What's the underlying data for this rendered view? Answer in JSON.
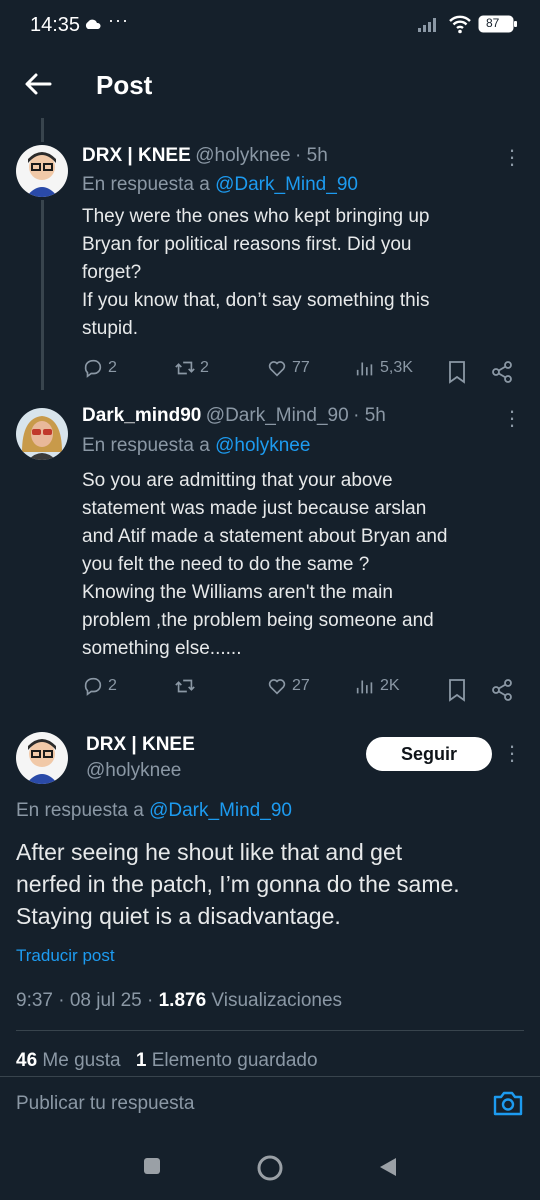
{
  "status_bar": {
    "time": "14:35",
    "more": "···",
    "battery": "87"
  },
  "header": {
    "title": "Post"
  },
  "tweets": [
    {
      "name": "DRX | KNEE",
      "handle": "@holyknee",
      "time": "· 5h",
      "reply_prefix": "En respuesta a",
      "reply_to": "@Dark_Mind_90",
      "text": "They were the ones who kept bringing up\nBryan for political reasons first. Did you\nforget?\nIf you know that, don’t say something this\nstupid.",
      "replies": "2",
      "retweets": "2",
      "likes": "77",
      "views": "5,3K"
    },
    {
      "name": "Dark_mind90",
      "handle": "@Dark_Mind_90",
      "time": "· 5h",
      "reply_prefix": "En respuesta a",
      "reply_to": "@holyknee",
      "text": "So you are admitting that your above\nstatement was made just because arslan\nand Atif made a statement about Bryan and\nyou felt the need to do the same ?\nKnowing the Williams aren't the main\nproblem ,the problem being someone and\nsomething else......",
      "replies": "2",
      "retweets": "",
      "likes": "27",
      "views": "2K"
    }
  ],
  "main_tweet": {
    "name": "DRX | KNEE",
    "handle": "@holyknee",
    "follow_label": "Seguir",
    "reply_prefix": "En respuesta a",
    "reply_to": "@Dark_Mind_90",
    "text": "After seeing he shout like that and get\nnerfed in the patch, I’m gonna do the same.\nStaying quiet is a disadvantage.",
    "translate": "Traducir post",
    "timestamp": "9:37 · 08 jul 25 · ",
    "views_count": "1.876",
    "views_label": "Visualizaciones",
    "likes_count": "46",
    "likes_label": "Me gusta",
    "saves_count": "1",
    "saves_label": "Elemento guardado"
  },
  "reply_bar": {
    "placeholder": "Publicar tu respuesta"
  },
  "colors": {
    "background": "#15202b",
    "accent": "#1d9bf0",
    "muted": "#8b98a5"
  }
}
